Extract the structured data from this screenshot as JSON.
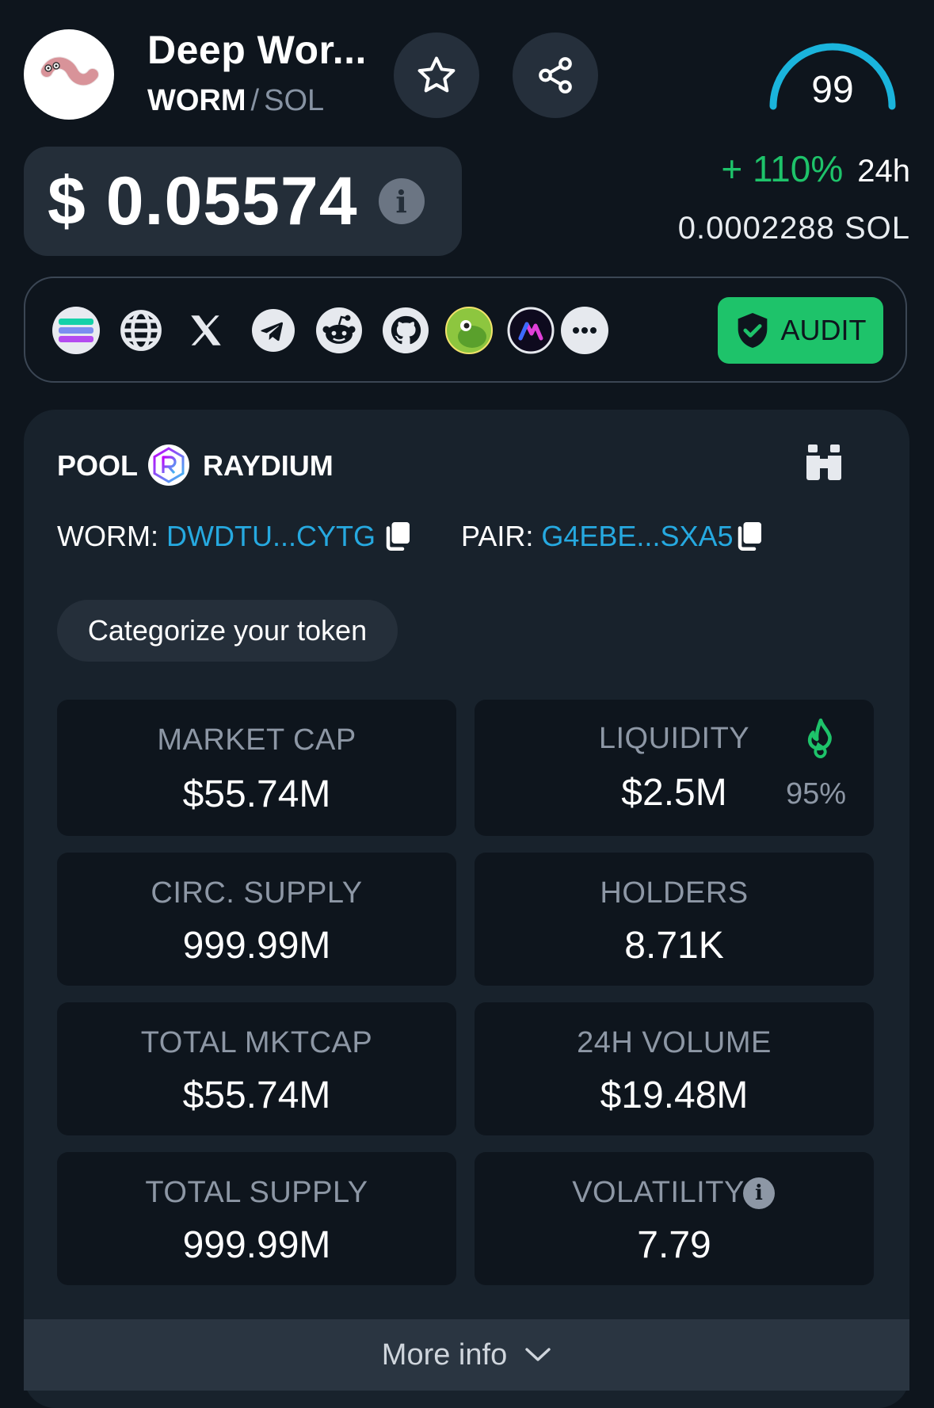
{
  "token": {
    "name": "Deep Wor...",
    "base": "WORM",
    "separator": "/",
    "quote": "SOL",
    "score": "99"
  },
  "price": {
    "usd": "$ 0.05574",
    "change_pct": "+ 110%",
    "change_period": "24h",
    "sol": "0.0002288  SOL"
  },
  "links": {
    "items": [
      "solana-icon",
      "globe-icon",
      "x-icon",
      "telegram-icon",
      "reddit-icon",
      "github-icon",
      "coingecko-icon",
      "dapp-icon",
      "more-icon"
    ],
    "audit_label": "AUDIT"
  },
  "pool": {
    "label": "POOL",
    "dex": "RAYDIUM",
    "token_key": "WORM:",
    "token_addr": "DWDTU...CYTG",
    "pair_key": "PAIR:",
    "pair_addr": "G4EBE...SXA5",
    "categorize": "Categorize your token"
  },
  "stats": {
    "market_cap": {
      "label": "MARKET CAP",
      "value": "$55.74M"
    },
    "liquidity": {
      "label": "LIQUIDITY",
      "value": "$2.5M",
      "burn_pct": "95%"
    },
    "circ_supply": {
      "label": "CIRC. SUPPLY",
      "value": "999.99M"
    },
    "holders": {
      "label": "HOLDERS",
      "value": "8.71K"
    },
    "total_mktcap": {
      "label": "TOTAL MKTCAP",
      "value": "$55.74M"
    },
    "volume_24h": {
      "label": "24H VOLUME",
      "value": "$19.48M"
    },
    "total_supply": {
      "label": "TOTAL SUPPLY",
      "value": "999.99M"
    },
    "volatility": {
      "label": "VOLATILITY",
      "value": "7.79"
    }
  },
  "more_info": "More info",
  "colors": {
    "background": "#0e151d",
    "card": "#18222c",
    "positive": "#1ec36a",
    "link": "#26a9e0",
    "gauge": "#1ab4dc"
  }
}
